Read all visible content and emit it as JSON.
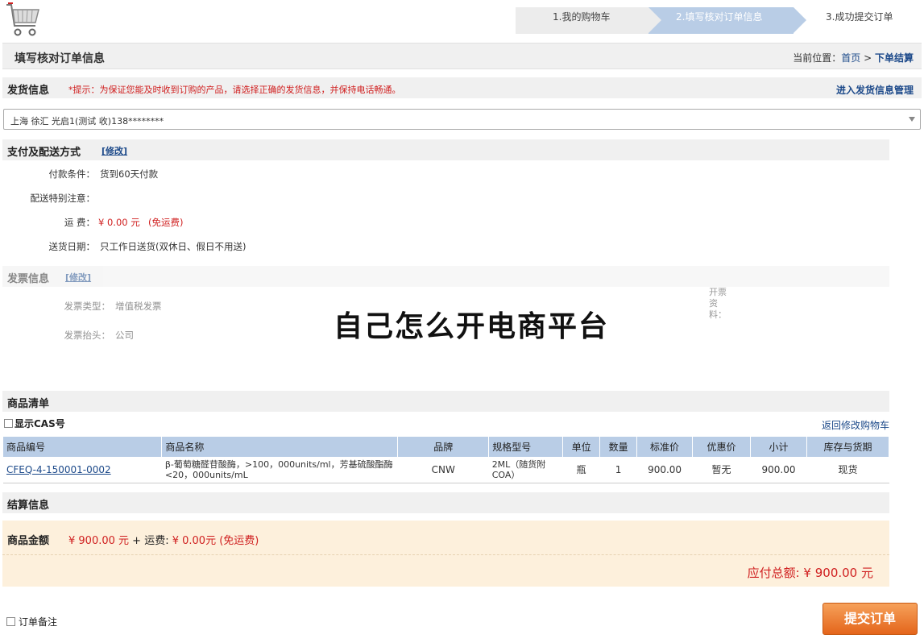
{
  "steps": [
    "1.我的购物车",
    "2.填写核对订单信息",
    "3.成功提交订单"
  ],
  "header": {
    "title": "填写核对订单信息",
    "breadcrumb_prefix": "当前位置：",
    "breadcrumb_home": "首页",
    "breadcrumb_sep": ">",
    "breadcrumb_current": "下单结算"
  },
  "shipping": {
    "title": "发货信息",
    "tip": "*提示：为保证您能及时收到订购的产品，请选择正确的发货信息，并保持电话畅通。",
    "manage_link": "进入发货信息管理",
    "selected_address": "上海 徐汇 光启1(测试 收)138********"
  },
  "payment": {
    "title": "支付及配送方式",
    "edit_label": "[修改]",
    "terms_label": "付款条件：",
    "terms_value": "货到60天付款",
    "note_label": "配送特别注意：",
    "fee_label": "运 费：",
    "fee_value": "¥ 0.00 元",
    "fee_free": "(免运费)",
    "date_label": "送货日期：",
    "date_value": "只工作日送货(双休日、假日不用送)"
  },
  "invoice": {
    "title": "发票信息",
    "edit_label": "[修改]",
    "type_label": "发票类型：",
    "type_value": "增值税发票",
    "header_label": "发票抬头：",
    "header_value": "公司",
    "info_label": "开票资料："
  },
  "watermark": "自己怎么开电商平台",
  "goods": {
    "title": "商品清单",
    "show_cas": "显示CAS号",
    "back_link": "返回修改购物车",
    "columns": [
      "商品编号",
      "商品名称",
      "品牌",
      "规格型号",
      "单位",
      "数量",
      "标准价",
      "优惠价",
      "小计",
      "库存与货期"
    ],
    "rows": [
      {
        "code": "CFEQ-4-150001-0002",
        "name": "β-葡萄糖醛苷酸酶，>100，000units/ml，芳基硫酸酯酶<20，000units/mL",
        "brand": "CNW",
        "spec": "2ML（随货附COA）",
        "unit": "瓶",
        "qty": "1",
        "price": "900.00",
        "discount": "暂无",
        "subtotal": "900.00",
        "stock": "现货"
      }
    ]
  },
  "settle": {
    "title": "结算信息",
    "amount_label": "商品金额",
    "amount_value": "¥ 900.00 元",
    "plus": "+ 运费:",
    "fee_value": "¥ 0.00元 (免运费)",
    "total": "应付总额: ¥ 900.00 元"
  },
  "footer": {
    "remark": "订单备注",
    "submit": "提交订单"
  }
}
